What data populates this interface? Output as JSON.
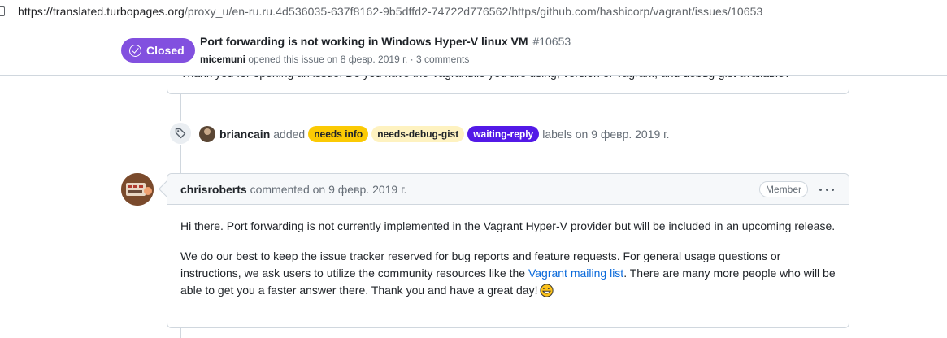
{
  "browser": {
    "url_prefix": "https://translated.turbopages.org",
    "url_rest": "/proxy_u/en-ru.ru.4d536035-637f8162-9b5dffd2-74722d776562/https/github.com/hashicorp/vagrant/issues/10653"
  },
  "issue": {
    "state": "Closed",
    "title": "Port forwarding is not working in Windows Hyper-V linux VM",
    "number": "#10653",
    "author": "micemuni",
    "meta_text": "opened this issue on 8 февр. 2019 г. · 3 comments",
    "state_color": "#8250df"
  },
  "previous_comment": {
    "text": "Thank you for opening an issue. Do you have the Vagrantfile you are using, version of Vagrant, and debug-gist available?"
  },
  "label_event": {
    "icon": "tag-icon",
    "actor": "briancain",
    "verb": "added",
    "labels": [
      {
        "name": "needs info",
        "bg": "#fbca04",
        "fg": "#1f2328"
      },
      {
        "name": "needs-debug-gist",
        "bg": "#fef2c0",
        "fg": "#1f2328"
      },
      {
        "name": "waiting-reply",
        "bg": "#5319e7",
        "fg": "#ffffff"
      }
    ],
    "suffix": "labels on 9 февр. 2019 г."
  },
  "comment": {
    "author": "chrisroberts",
    "action": "commented on 9 февр. 2019 г.",
    "role": "Member",
    "p1": "Hi there. Port forwarding is not currently implemented in the Vagrant Hyper-V provider but will be included in an upcoming release.",
    "p2_before": "We do our best to keep the issue tracker reserved for bug reports and feature requests. For general usage questions or instructions, we ask users to utilize the community resources like the ",
    "p2_link": "Vagrant mailing list",
    "p2_after": ". There are many more people who will be able to get you a faster answer there. Thank you and have a great day!",
    "emoji": "smile-emoji"
  }
}
